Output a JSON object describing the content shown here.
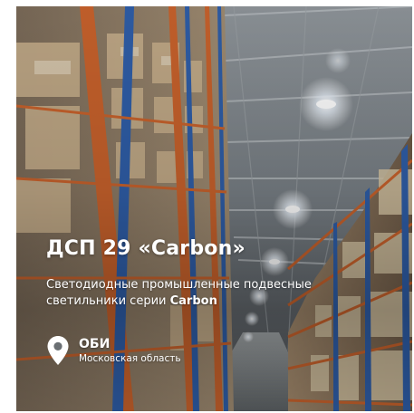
{
  "card": {
    "title": "ДСП 29 «Carbon»",
    "subtitle_text": "Светодиодные промышленные подвесные светильники серии ",
    "subtitle_emphasis": "Carbon",
    "location": {
      "icon": "map-pin-icon",
      "name": "ОБИ",
      "region": "Московская область"
    }
  },
  "colors": {
    "text": "#ffffff",
    "shelving_orange": "#c8622c",
    "shelving_blue": "#2f5ea8",
    "lamp_glow": "#ffffff"
  }
}
